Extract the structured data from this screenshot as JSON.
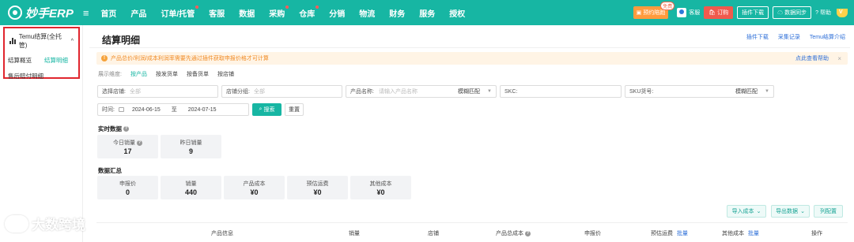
{
  "brand": {
    "name": "妙手ERP",
    "accent": "#17b6a3",
    "alert_bg": "#fff4e5",
    "highlight": "#e0262e"
  },
  "topnav": {
    "items": [
      {
        "label": "首页",
        "dot": false
      },
      {
        "label": "产品",
        "dot": false
      },
      {
        "label": "订单/托管",
        "dot": true
      },
      {
        "label": "客服",
        "dot": false
      },
      {
        "label": "数据",
        "dot": false
      },
      {
        "label": "采购",
        "dot": true
      },
      {
        "label": "仓库",
        "dot": true
      },
      {
        "label": "分销",
        "dot": false
      },
      {
        "label": "物流",
        "dot": false
      },
      {
        "label": "财务",
        "dot": false
      },
      {
        "label": "服务",
        "dot": false
      },
      {
        "label": "授权",
        "dot": false
      }
    ],
    "right": {
      "consult": "预约陪跑",
      "free_badge": "免费",
      "service": "客服",
      "order": "订购",
      "plugin_download": "插件下载",
      "data_sync": "数据同步",
      "help": "帮助"
    }
  },
  "sidebar": {
    "group": "Temu结算(全托管)",
    "items": [
      {
        "label": "结算概览"
      },
      {
        "label": "结算明细"
      },
      {
        "label": "售后赔付明细"
      }
    ]
  },
  "page": {
    "title": "结算明细",
    "links": [
      "插件下载",
      "采集记录",
      "Temu结算介绍"
    ],
    "alert": "产品总价/利润/成本利润率需要先通过插件获取申报价格才可计算",
    "alert_link": "点此查看帮助"
  },
  "filters": {
    "dimension_label": "展示维度:",
    "dimensions": [
      "按产品",
      "按发货单",
      "按备货单",
      "按店铺"
    ],
    "store_label": "选择店铺:",
    "store_value": "全部",
    "group_label": "店铺分组:",
    "group_value": "全部",
    "name_label": "产品名称:",
    "name_placeholder": "请输入产品名称",
    "name_mode": "模糊匹配",
    "skc_label": "SKC:",
    "sku_label": "SKU货号:",
    "sku_mode": "模糊匹配",
    "time_label": "时间:",
    "date_from": "2024-06-15",
    "date_to_label": "至",
    "date_to": "2024-07-15",
    "search": "搜索",
    "reset": "重置"
  },
  "realtime": {
    "title": "实时数据",
    "cards": [
      {
        "label": "今日销量",
        "value": "17"
      },
      {
        "label": "昨日销量",
        "value": "9"
      }
    ]
  },
  "summary": {
    "title": "数据汇总",
    "cards": [
      {
        "label": "申报价",
        "value": "0"
      },
      {
        "label": "销量",
        "value": "440"
      },
      {
        "label": "产品成本",
        "value": "¥0"
      },
      {
        "label": "预估运费",
        "value": "¥0"
      },
      {
        "label": "其他成本",
        "value": "¥0"
      }
    ]
  },
  "actions": {
    "import_cost": "导入成本",
    "export": "导出数据",
    "columns": "列配置"
  },
  "table": {
    "headers": [
      "产品信息",
      "销量",
      "店铺",
      "产品总成本",
      "申报价",
      "预估运费",
      "其他成本",
      "操作"
    ],
    "batch": "批量"
  },
  "watermark": "大数跨境"
}
